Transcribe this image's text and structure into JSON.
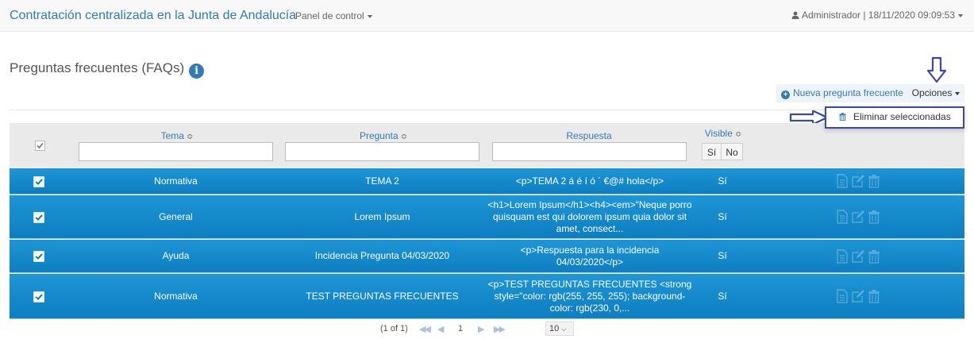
{
  "navbar": {
    "brand": "Contratación centralizada en la Junta de Andalucía",
    "panel_menu": "Panel de control",
    "user": "Administrador | 18/11/2020 09:09:53"
  },
  "page": {
    "title": "Preguntas frecuentes (FAQs)",
    "info_icon_glyph": "i"
  },
  "toolbar": {
    "new_button": "Nueva pregunta frecuente",
    "options_button": "Opciones",
    "dropdown_item": "Eliminar seleccionadas"
  },
  "table": {
    "headers": {
      "tema": "Tema",
      "pregunta": "Pregunta",
      "respuesta": "Respuesta",
      "visible": "Visible",
      "sort_glyph": "≎"
    },
    "visible_filter": {
      "yes": "Sí",
      "no": "No"
    },
    "rows": [
      {
        "tema": "Normativa",
        "pregunta": "TEMA 2",
        "respuesta": "<p>TEMA 2 á é í ó ´ €@# hola</p>",
        "visible": "Sí"
      },
      {
        "tema": "General",
        "pregunta": "Lorem Ipsum",
        "respuesta": "<h1>Lorem Ipsum</h1><h4><em>\"Neque porro quisquam est qui dolorem ipsum quia dolor sit amet, consect...",
        "visible": "Sí"
      },
      {
        "tema": "Ayuda",
        "pregunta": "Incidencia Pregunta 04/03/2020",
        "respuesta": "<p>Respuesta para la incidencia 04/03/2020</p>",
        "visible": "Sí"
      },
      {
        "tema": "Normativa",
        "pregunta": "TEST PREGUNTAS FRECUENTES",
        "respuesta": "<p>TEST PREGUNTAS FRECUENTES <strong style=\"color: rgb(255, 255, 255); background-color: rgb(230, 0,...",
        "visible": "Sí"
      }
    ]
  },
  "pagination": {
    "summary": "(1 of 1)",
    "first": "◀◀",
    "prev": "◀",
    "page": "1",
    "next": "▶",
    "last": "▶▶",
    "per_page": "10"
  },
  "colors": {
    "accent": "#337ab7",
    "row_bg": "#1489cb",
    "annotation": "#3949ab"
  },
  "icons": [
    "user-icon",
    "info-icon",
    "plus-circle-icon",
    "caret-icon",
    "trash-icon",
    "document-icon",
    "edit-icon",
    "sort-icon",
    "arrow-down-annotation",
    "arrow-right-annotation"
  ]
}
